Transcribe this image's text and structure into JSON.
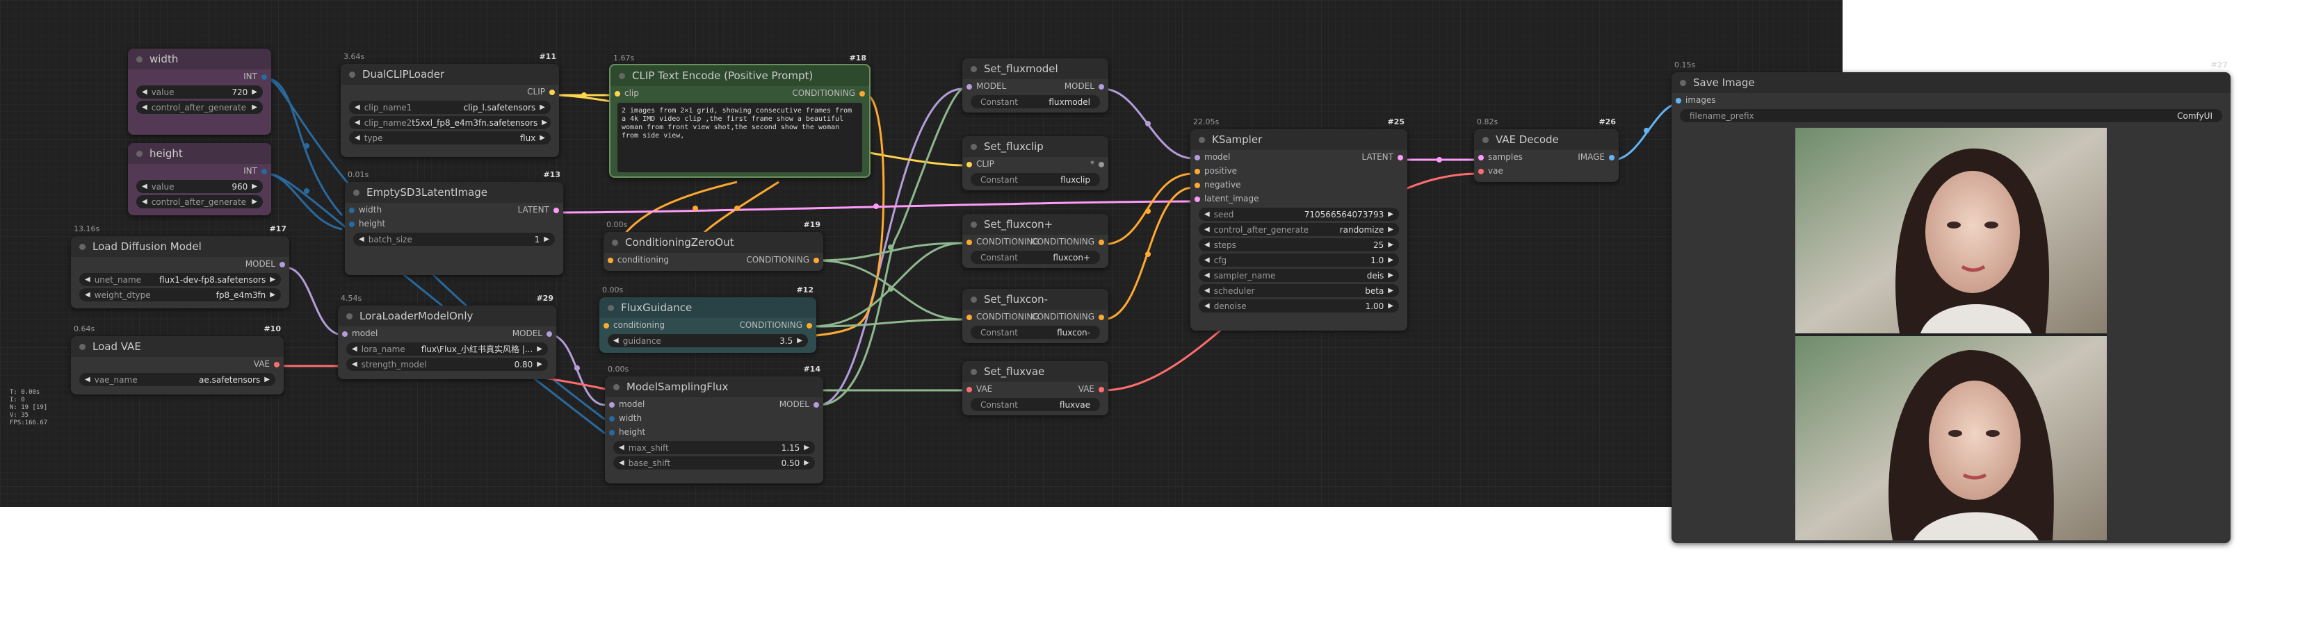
{
  "colors": {
    "model": "#b39ddb",
    "clip": "#ffd54f",
    "conditioning": "#ffa931",
    "latent": "#ff9cf9",
    "vae": "#ff6e6e",
    "image": "#64b5f6",
    "int": "#29699c",
    "green_link": "#8fb88f"
  },
  "nodes": {
    "width": {
      "title": "width",
      "out": "INT",
      "widgets": [
        {
          "label": "value",
          "value": "720"
        },
        {
          "label": "control_after_generate",
          "value": ""
        }
      ]
    },
    "height": {
      "title": "height",
      "out": "INT",
      "widgets": [
        {
          "label": "value",
          "value": "960"
        },
        {
          "label": "control_after_generate",
          "value": ""
        }
      ]
    },
    "load_diffusion": {
      "time": "13.16s",
      "badge": "#17",
      "title": "Load Diffusion Model",
      "out": "MODEL",
      "widgets": [
        {
          "label": "unet_name",
          "value": "flux1-dev-fp8.safetensors"
        },
        {
          "label": "weight_dtype",
          "value": "fp8_e4m3fn"
        }
      ]
    },
    "load_vae": {
      "time": "0.64s",
      "badge": "#10",
      "title": "Load VAE",
      "out": "VAE",
      "widgets": [
        {
          "label": "vae_name",
          "value": "ae.safetensors"
        }
      ]
    },
    "dual_clip": {
      "time": "3.64s",
      "badge": "#11",
      "title": "DualCLIPLoader",
      "out": "CLIP",
      "widgets": [
        {
          "label": "clip_name1",
          "value": "clip_l.safetensors"
        },
        {
          "label": "clip_name2",
          "value": "t5xxl_fp8_e4m3fn.safetensors"
        },
        {
          "label": "type",
          "value": "flux"
        }
      ]
    },
    "empty_latent": {
      "time": "0.01s",
      "badge": "#13",
      "title": "EmptySD3LatentImage",
      "in1": "width",
      "in2": "height",
      "out": "LATENT",
      "widgets": [
        {
          "label": "batch_size",
          "value": "1"
        }
      ]
    },
    "lora": {
      "time": "4.54s",
      "badge": "#29",
      "title": "LoraLoaderModelOnly",
      "in": "model",
      "out": "MODEL",
      "widgets": [
        {
          "label": "lora_name",
          "value": "flux\\Flux_小红书真实风格 |..."
        },
        {
          "label": "strength_model",
          "value": "0.80"
        }
      ]
    },
    "clip_text": {
      "time": "1.67s",
      "badge": "#18",
      "title": "CLIP Text Encode (Positive Prompt)",
      "in": "clip",
      "out": "CONDITIONING",
      "text": "2 images from  2×1 grid, showing consecutive frames from a  4k IMD video clip ,the first frame show a beautiful woman from front view shot,the second show the woman from side view,"
    },
    "zero_out": {
      "time": "0.00s",
      "badge": "#19",
      "title": "ConditioningZeroOut",
      "in": "conditioning",
      "out": "CONDITIONING"
    },
    "flux_guidance": {
      "time": "0.00s",
      "badge": "#12",
      "title": "FluxGuidance",
      "in": "conditioning",
      "out": "CONDITIONING",
      "widgets": [
        {
          "label": "guidance",
          "value": "3.5"
        }
      ]
    },
    "model_sampling": {
      "time": "0.00s",
      "badge": "#14",
      "title": "ModelSamplingFlux",
      "in1": "model",
      "in2": "width",
      "in3": "height",
      "out": "MODEL",
      "widgets": [
        {
          "label": "max_shift",
          "value": "1.15"
        },
        {
          "label": "base_shift",
          "value": "0.50"
        }
      ]
    },
    "set_fluxmodel": {
      "title": "Set_fluxmodel",
      "in": "MODEL",
      "out": "MODEL",
      "const_label": "Constant",
      "const_value": "fluxmodel"
    },
    "set_fluxclip": {
      "title": "Set_fluxclip",
      "in": "CLIP",
      "out": "*",
      "const_label": "Constant",
      "const_value": "fluxclip"
    },
    "set_fluxconp": {
      "title": "Set_fluxcon+",
      "in": "CONDITIONING",
      "out": "CONDITIONING",
      "const_label": "Constant",
      "const_value": "fluxcon+"
    },
    "set_fluxconm": {
      "title": "Set_fluxcon-",
      "in": "CONDITIONING",
      "out": "CONDITIONING",
      "const_label": "Constant",
      "const_value": "fluxcon-"
    },
    "set_fluxvae": {
      "title": "Set_fluxvae",
      "in": "VAE",
      "out": "VAE",
      "const_label": "Constant",
      "const_value": "fluxvae"
    },
    "ksampler": {
      "time": "22.05s",
      "badge": "#25",
      "title": "KSampler",
      "inputs": [
        "model",
        "positive",
        "negative",
        "latent_image"
      ],
      "out": "LATENT",
      "widgets": [
        {
          "label": "seed",
          "value": "710566564073793"
        },
        {
          "label": "control_after_generate",
          "value": "randomize"
        },
        {
          "label": "steps",
          "value": "25"
        },
        {
          "label": "cfg",
          "value": "1.0"
        },
        {
          "label": "sampler_name",
          "value": "deis"
        },
        {
          "label": "scheduler",
          "value": "beta"
        },
        {
          "label": "denoise",
          "value": "1.00"
        }
      ]
    },
    "vae_decode": {
      "time": "0.82s",
      "badge": "#26",
      "title": "VAE Decode",
      "in1": "samples",
      "in2": "vae",
      "out": "IMAGE"
    },
    "save_image": {
      "time": "0.15s",
      "badge": "#27",
      "title": "Save Image",
      "in": "images",
      "widgets": [
        {
          "label": "filename_prefix",
          "value": "ComfyUI"
        }
      ]
    }
  },
  "stats": [
    "T: 0.00s",
    "I: 0",
    "N: 19 [19]",
    "V: 35",
    "FPS:166.67"
  ]
}
